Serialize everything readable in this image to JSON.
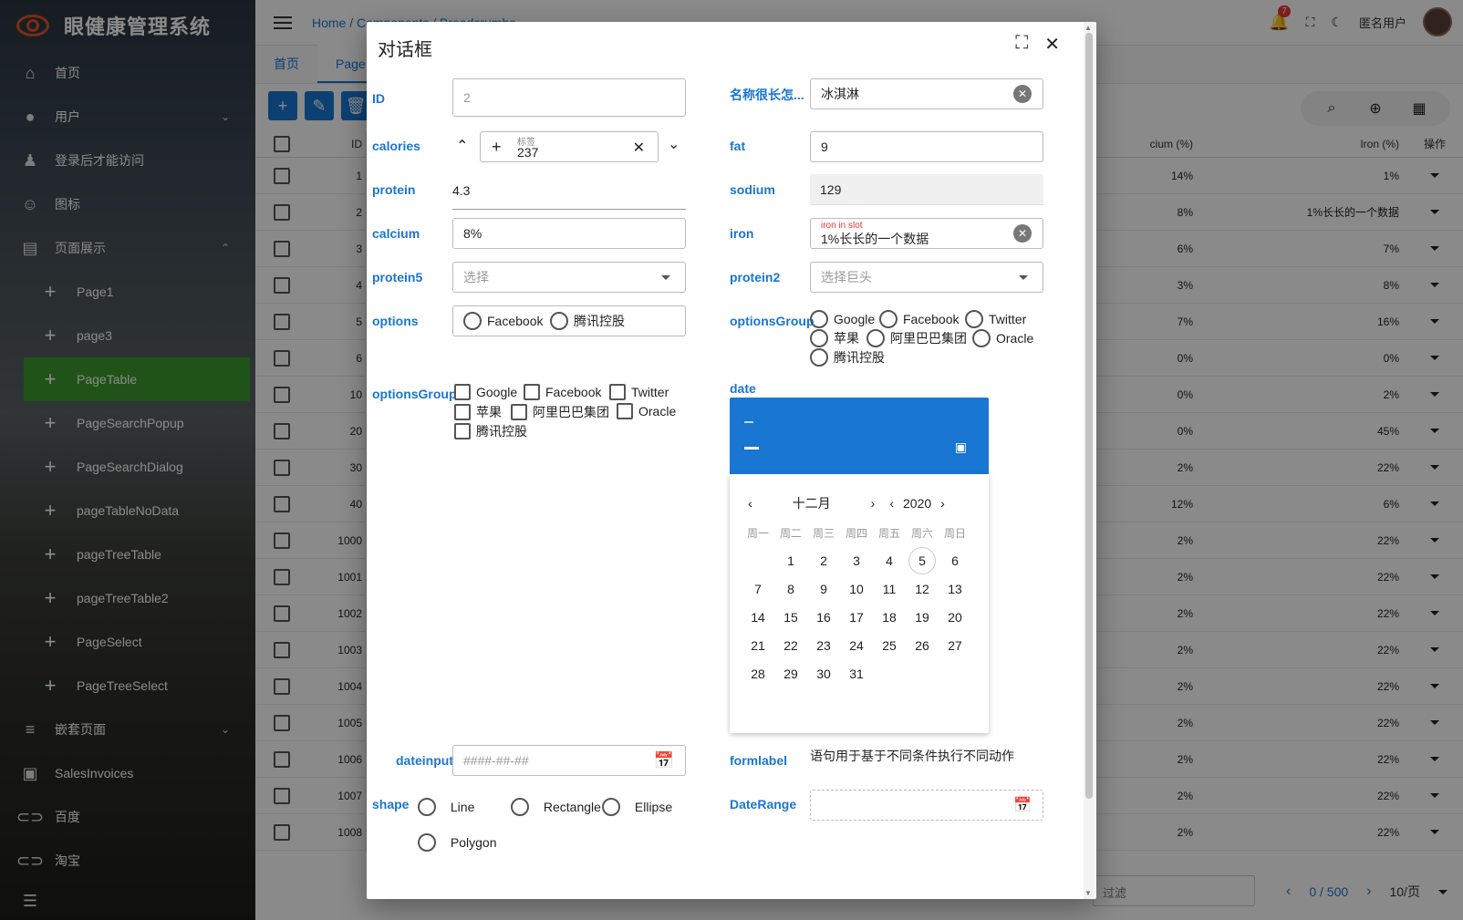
{
  "app": {
    "title": "眼健康管理系统"
  },
  "sidebar": {
    "items": [
      {
        "label": "首页",
        "icon": "home-icon"
      },
      {
        "label": "用户",
        "icon": "account-icon"
      },
      {
        "label": "登录后才能访问",
        "icon": "user-check-icon"
      },
      {
        "label": "图标",
        "icon": "smile-icon"
      },
      {
        "label": "页面展示",
        "icon": "table-icon"
      },
      {
        "label": "Page1"
      },
      {
        "label": "page3"
      },
      {
        "label": "PageTable"
      },
      {
        "label": "PageSearchPopup"
      },
      {
        "label": "PageSearchDialog"
      },
      {
        "label": "pageTableNoData"
      },
      {
        "label": "pageTreeTable"
      },
      {
        "label": "pageTreeTable2"
      },
      {
        "label": "PageSelect"
      },
      {
        "label": "PageTreeSelect"
      },
      {
        "label": "嵌套页面",
        "icon": "list-icon"
      },
      {
        "label": "SalesInvoices",
        "icon": "invoice-icon"
      },
      {
        "label": "百度",
        "icon": "link-icon"
      },
      {
        "label": "淘宝",
        "icon": "link-icon"
      }
    ]
  },
  "topbar": {
    "breadcrumb": "Home / Components / Breadcrumbs",
    "badge_count": "7",
    "user_name": "匿名用户"
  },
  "tabs": [
    {
      "label": "首页"
    },
    {
      "label": "Page"
    }
  ],
  "table": {
    "headers": {
      "id": "ID",
      "calcium": "cium (%)",
      "iron": "Iron (%)",
      "ops": "操作"
    },
    "rows": [
      {
        "id": "1",
        "calcium": "14%",
        "iron": "1%"
      },
      {
        "id": "2",
        "calcium": "8%",
        "iron": "1%长长的一个数据"
      },
      {
        "id": "3",
        "calcium": "6%",
        "iron": "7%"
      },
      {
        "id": "4",
        "calcium": "3%",
        "iron": "8%"
      },
      {
        "id": "5",
        "calcium": "7%",
        "iron": "16%"
      },
      {
        "id": "6",
        "calcium": "0%",
        "iron": "0%"
      },
      {
        "id": "10",
        "calcium": "0%",
        "iron": "2%"
      },
      {
        "id": "20",
        "calcium": "0%",
        "iron": "45%"
      },
      {
        "id": "30",
        "calcium": "2%",
        "iron": "22%"
      },
      {
        "id": "40",
        "calcium": "12%",
        "iron": "6%"
      },
      {
        "id": "1000",
        "calcium": "2%",
        "iron": "22%"
      },
      {
        "id": "1001",
        "calcium": "2%",
        "iron": "22%"
      },
      {
        "id": "1002",
        "calcium": "2%",
        "iron": "22%"
      },
      {
        "id": "1003",
        "calcium": "2%",
        "iron": "22%"
      },
      {
        "id": "1004",
        "calcium": "2%",
        "iron": "22%"
      },
      {
        "id": "1005",
        "calcium": "2%",
        "iron": "22%"
      },
      {
        "id": "1006",
        "calcium": "2%",
        "iron": "22%"
      },
      {
        "id": "1007",
        "calcium": "2%",
        "iron": "22%"
      },
      {
        "id": "1008",
        "calcium": "2%",
        "iron": "22%"
      }
    ]
  },
  "footer": {
    "filter_placeholder": "过滤",
    "count": "0 / 500",
    "per_page": "10/页"
  },
  "dialog": {
    "title": "对话框",
    "fields": {
      "id_label": "ID",
      "id_value": "2",
      "name_label": "名称很长怎...",
      "name_value": "冰淇淋",
      "calories_label": "calories",
      "calories_small": "标签",
      "calories_value": "237",
      "fat_label": "fat",
      "fat_value": "9",
      "protein_label": "protein",
      "protein_value": "4.3",
      "sodium_label": "sodium",
      "sodium_value": "129",
      "calcium_label": "calcium",
      "calcium_value": "8%",
      "iron_label": "iron",
      "iron_small": "iron in slot",
      "iron_value": "1%长长的一个数据",
      "protein5_label": "protein5",
      "protein5_placeholder": "选择",
      "protein2_label": "protein2",
      "protein2_placeholder": "选择巨头",
      "options_label": "options",
      "options_items": [
        "Facebook",
        "腾讯控股"
      ],
      "optionsGroup_label": "optionsGroup",
      "optionsGroup_radio": [
        "Google",
        "Facebook",
        "Twitter",
        "苹果",
        "阿里巴巴集团",
        "Oracle",
        "腾讯控股"
      ],
      "optionsGroup2_label": "optionsGroup",
      "optionsGroup_check": [
        "Google",
        "Facebook",
        "Twitter",
        "苹果",
        "阿里巴巴集团",
        "Oracle",
        "腾讯控股"
      ],
      "date_label": "date",
      "dateinput_label": "dateinput",
      "dateinput_placeholder": "####-##-##",
      "formlabel_label": "formlabel",
      "formlabel_text": "语句用于基于不同条件执行不同动作",
      "shape_label": "shape",
      "shape_items": [
        "Line",
        "Rectangle",
        "Ellipse",
        "Polygon"
      ],
      "daterange_label": "DateRange"
    },
    "calendar": {
      "month": "十二月",
      "year": "2020",
      "weekdays": [
        "周一",
        "周二",
        "周三",
        "周四",
        "周五",
        "周六",
        "周日"
      ],
      "days": [
        "1",
        "2",
        "3",
        "4",
        "5",
        "6",
        "7",
        "8",
        "9",
        "10",
        "11",
        "12",
        "13",
        "14",
        "15",
        "16",
        "17",
        "18",
        "19",
        "20",
        "21",
        "22",
        "23",
        "24",
        "25",
        "26",
        "27",
        "28",
        "29",
        "30",
        "31"
      ],
      "today": "5"
    }
  }
}
